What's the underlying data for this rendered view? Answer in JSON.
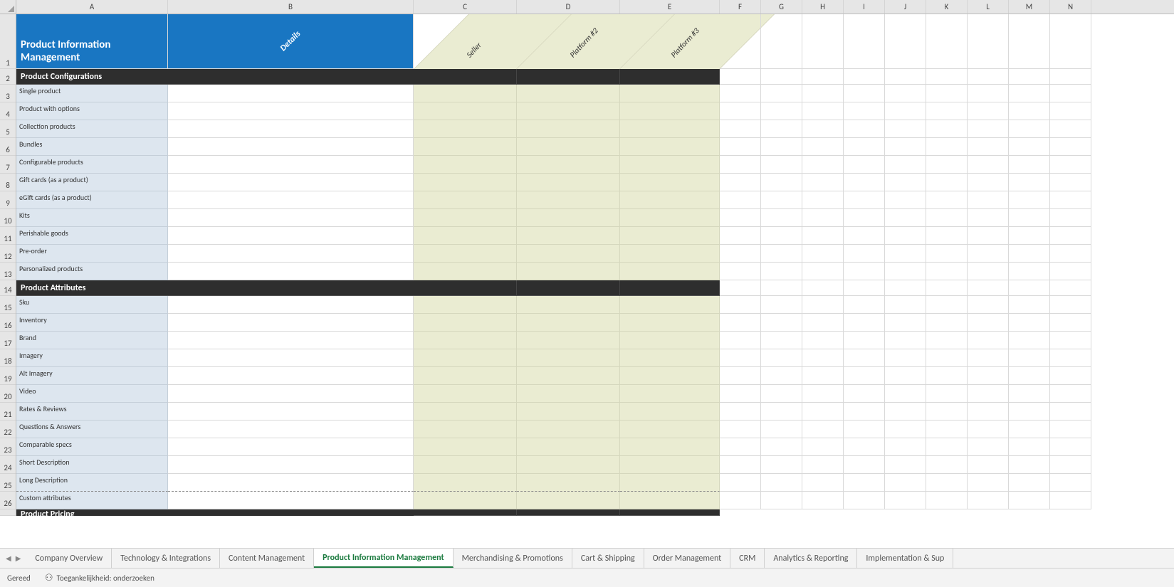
{
  "columns": {
    "letters": [
      "A",
      "B",
      "C",
      "D",
      "E",
      "F",
      "G",
      "H",
      "I",
      "J",
      "K",
      "L",
      "M",
      "N"
    ],
    "widths_class": [
      "cA",
      "cB",
      "cC",
      "cD",
      "cE",
      "cRest",
      "cRest",
      "cRest",
      "cRest",
      "cRest",
      "cRest",
      "cRest",
      "cRest",
      "cRest"
    ]
  },
  "header_row": {
    "title": "Product Information Management",
    "details_label": "Details",
    "platform_cols": [
      "Seller",
      "Platform #2",
      "Platform #3"
    ]
  },
  "sections": [
    {
      "name": "Product Configurations",
      "rows": [
        "Single product",
        "Product with options",
        "Collection products",
        "Bundles",
        "Configurable products",
        "Gift cards (as a product)",
        "eGift cards (as a product)",
        "Kits",
        "Perishable goods",
        "Pre-order",
        "Personalized products"
      ]
    },
    {
      "name": "Product Attributes",
      "rows": [
        "Sku",
        "Inventory",
        "Brand",
        "Imagery",
        "Alt Imagery",
        "Video",
        "Rates & Reviews",
        "Questions & Answers",
        "Comparable specs",
        "Short Description",
        "Long Description",
        "Custom attributes"
      ]
    },
    {
      "name": "Product Pricing",
      "rows": []
    }
  ],
  "row_heights": {
    "header": 77,
    "section": 22,
    "data": 25
  },
  "sheet_tabs": {
    "tabs": [
      "Company Overview",
      "Technology & Integrations",
      "Content Management",
      "Product Information Management",
      "Merchandising & Promotions",
      "Cart & Shipping",
      "Order Management",
      "CRM",
      "Analytics & Reporting",
      "Implementation & Sup"
    ],
    "active_index": 3
  },
  "status_bar": {
    "ready": "Gereed",
    "accessibility": "Toegankelijkheid: onderzoeken"
  },
  "colors": {
    "header_blue": "#1976c2",
    "cream": "#eaecd2",
    "label_blue": "#dde6ef",
    "section_dark": "#2e2e2e",
    "active_tab_green": "#1a7a3e"
  }
}
